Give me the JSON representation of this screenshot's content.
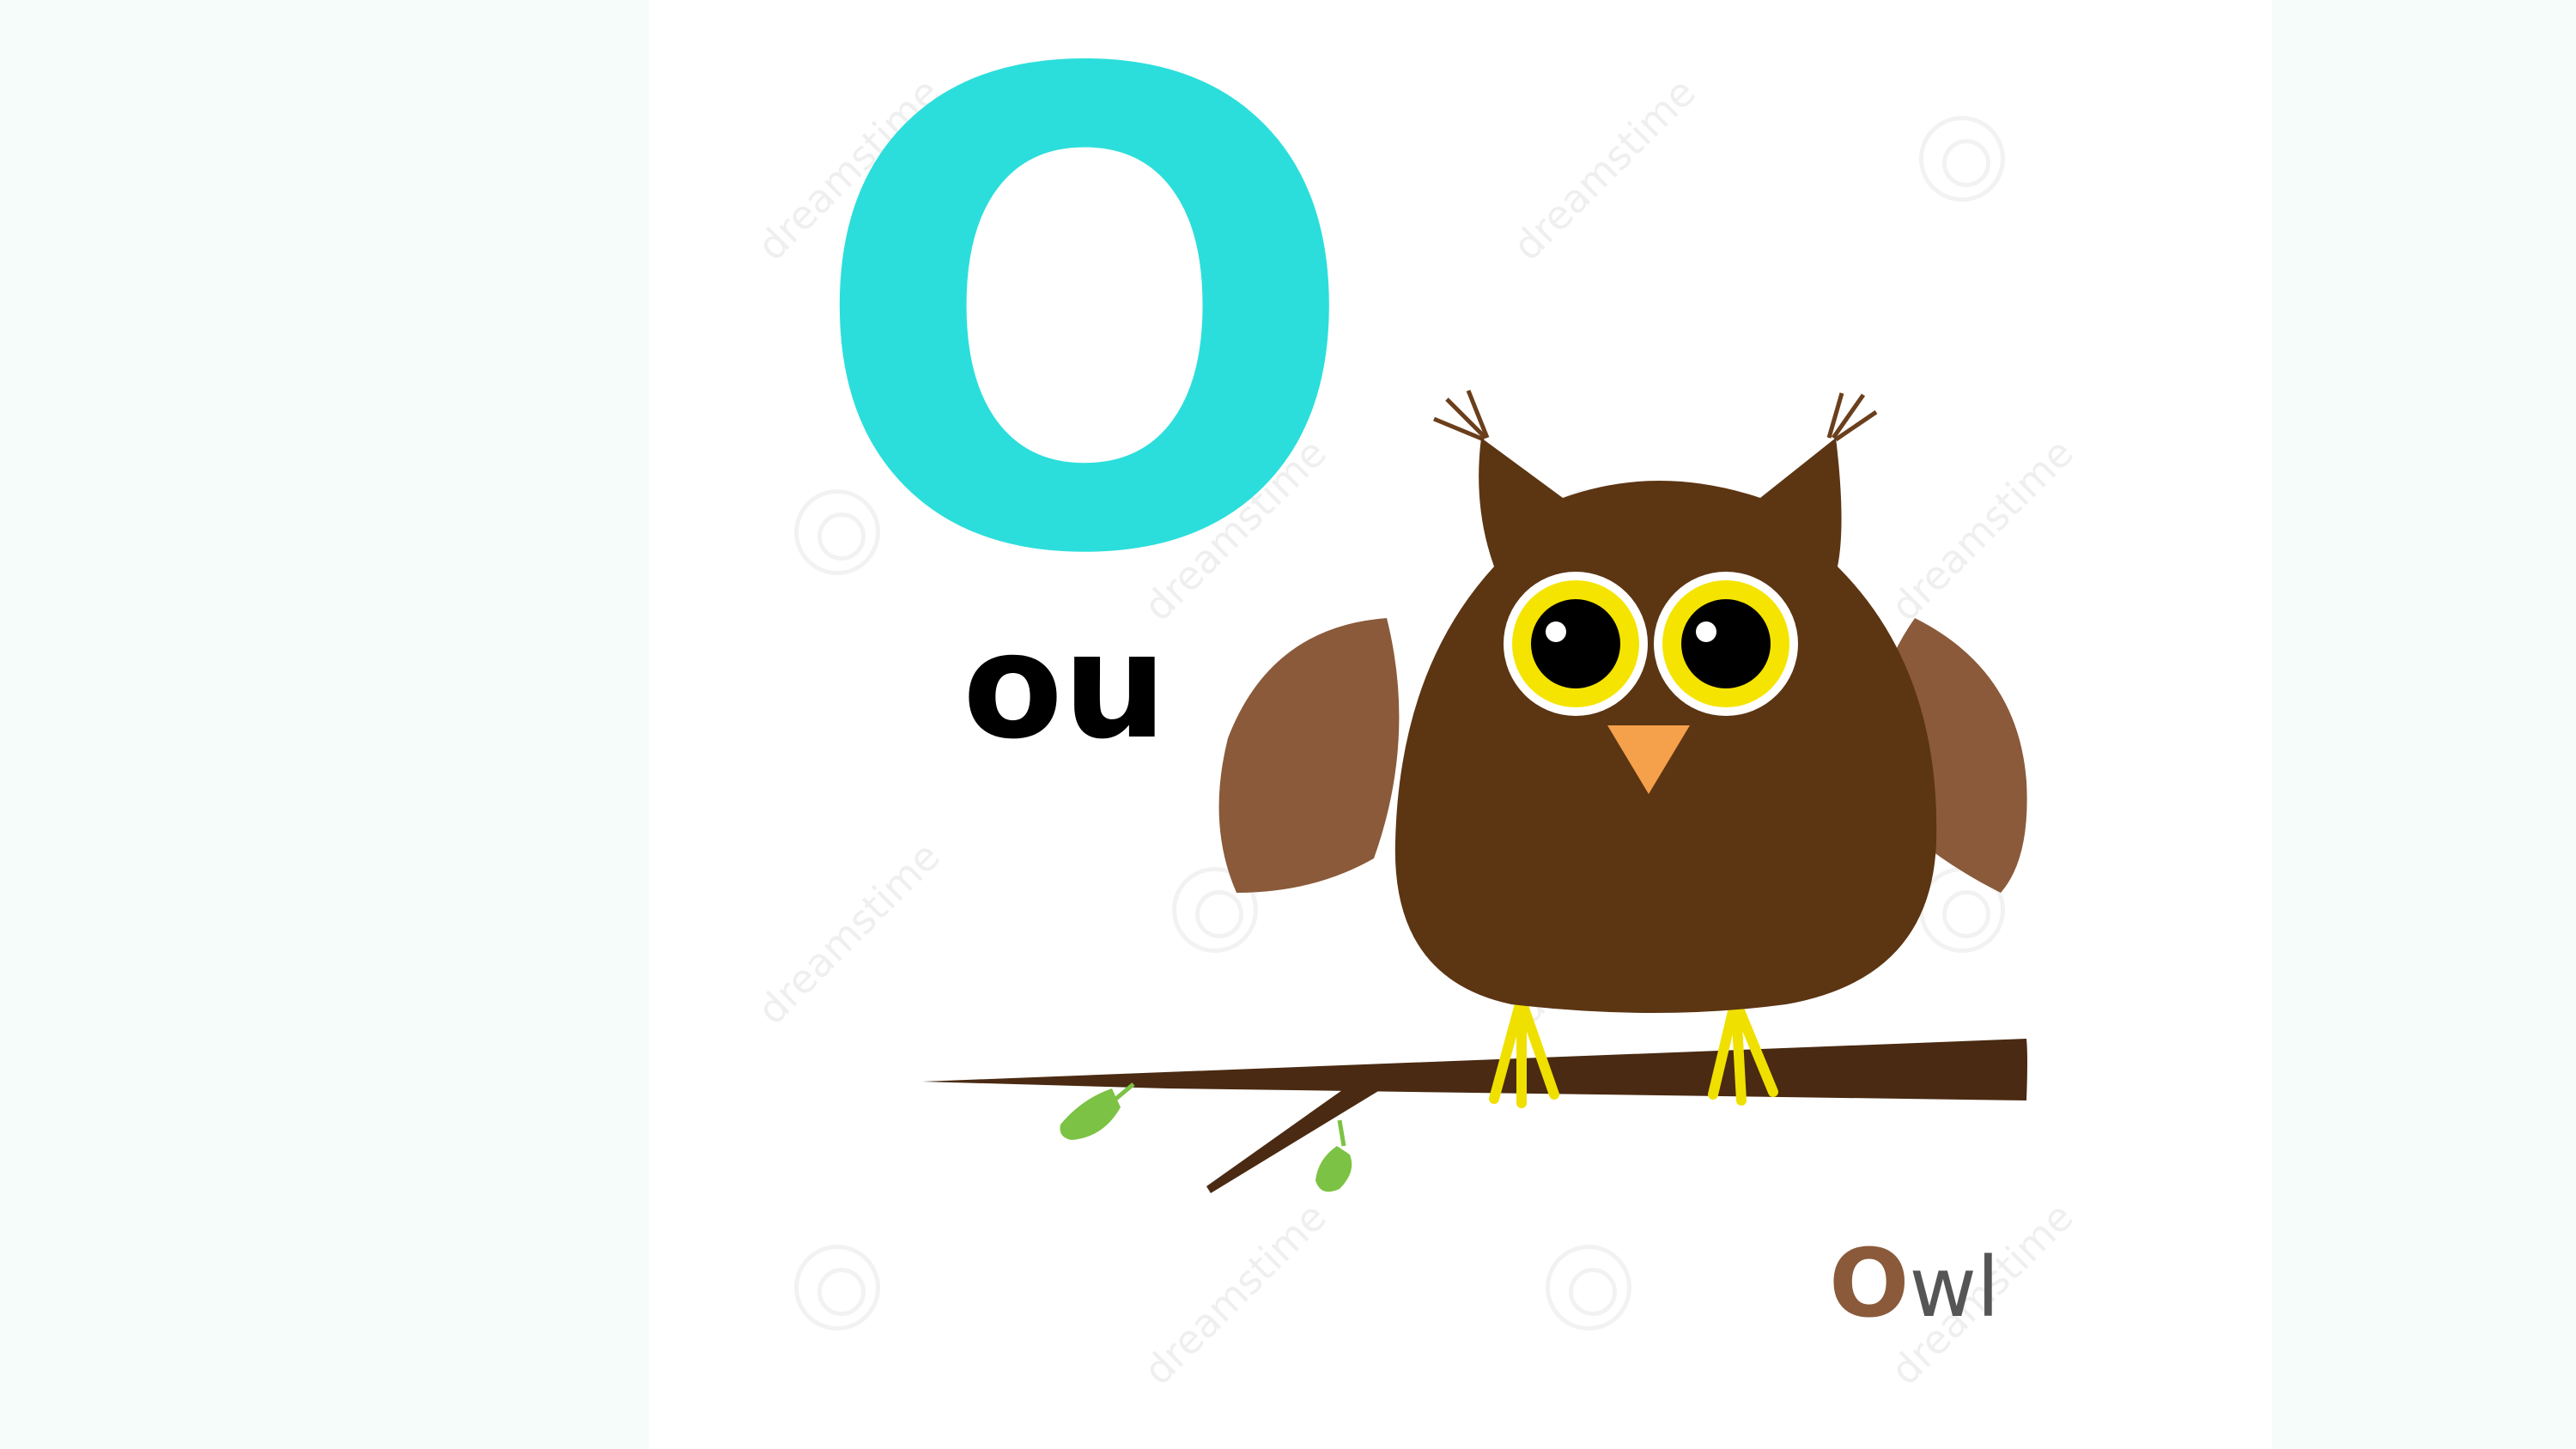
{
  "letter": "O",
  "phonetic": "ou",
  "word": {
    "first_letter": "O",
    "rest": "wl"
  },
  "watermark": "dreamstime",
  "colors": {
    "letter": "#2bdedb",
    "owl_body": "#5c3513",
    "owl_wing": "#8a5a3a",
    "owl_eye_ring": "#f5e400",
    "beak": "#f5a04a",
    "branch": "#4a2a12",
    "leaf": "#7cc244",
    "word_first": "#8a5a3a"
  }
}
